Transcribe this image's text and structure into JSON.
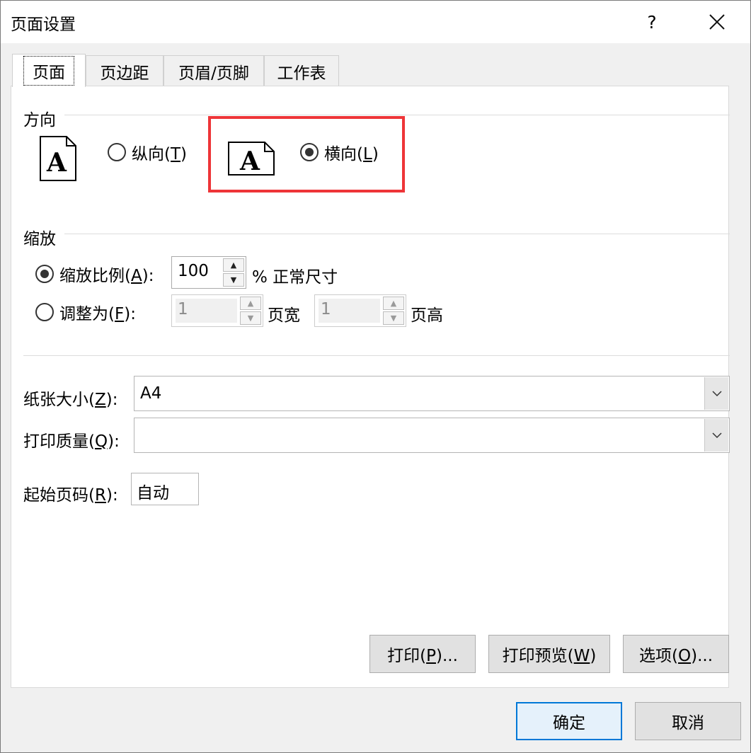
{
  "window": {
    "title": "页面设置",
    "help": "?"
  },
  "tabs": [
    {
      "label": "页面"
    },
    {
      "label": "页边距"
    },
    {
      "label": "页眉/页脚"
    },
    {
      "label": "工作表"
    }
  ],
  "orientation": {
    "group_title": "方向",
    "portrait": {
      "label": "纵向(",
      "key": "T",
      "suffix": ")",
      "checked": false
    },
    "landscape": {
      "label": "横向(",
      "key": "L",
      "suffix": ")",
      "checked": true
    },
    "icon_letter": "A",
    "highlight_color": "#ee3538"
  },
  "scaling": {
    "group_title": "缩放",
    "adjust_to": {
      "label": "缩放比例(",
      "key": "A",
      "suffix": "):",
      "value": "100",
      "unit": "% 正常尺寸",
      "checked": true
    },
    "fit_to": {
      "label": "调整为(",
      "key": "F",
      "suffix": "):",
      "wide_value": "1",
      "wide_unit": "页宽",
      "tall_value": "1",
      "tall_unit": "页高",
      "checked": false
    }
  },
  "paper_size": {
    "label": "纸张大小(",
    "key": "Z",
    "suffix": "):",
    "value": "A4"
  },
  "print_quality": {
    "label": "打印质量(",
    "key": "Q",
    "suffix": "):",
    "value": ""
  },
  "first_page_number": {
    "label": "起始页码(",
    "key": "R",
    "suffix": "):",
    "value": "自动"
  },
  "panel_buttons": {
    "print": {
      "label": "打印(",
      "key": "P",
      "suffix": ")..."
    },
    "preview": {
      "label": "打印预览(",
      "key": "W",
      "suffix": ")"
    },
    "options": {
      "label": "选项(",
      "key": "O",
      "suffix": ")..."
    }
  },
  "footer_buttons": {
    "ok": "确定",
    "cancel": "取消"
  },
  "colors": {
    "accent": "#0078d7",
    "highlight": "#ee3538"
  }
}
